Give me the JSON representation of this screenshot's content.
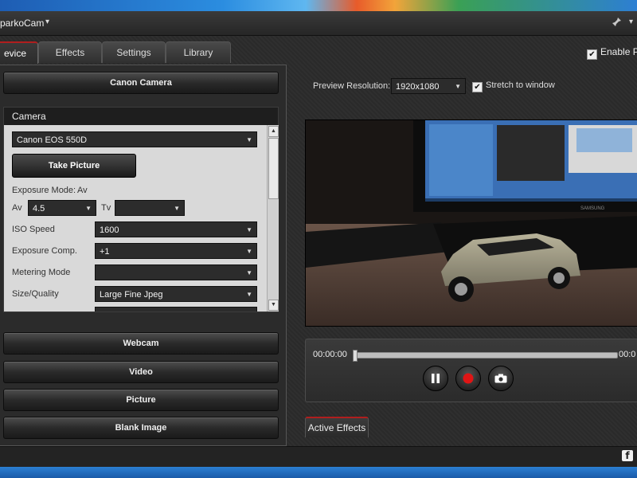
{
  "window": {
    "title": "parkoCam",
    "title_caret": "▾",
    "menu_caret": "▾"
  },
  "tabs": [
    {
      "label": "evice"
    },
    {
      "label": "Effects"
    },
    {
      "label": "Settings"
    },
    {
      "label": "Library"
    }
  ],
  "enable_preview": {
    "label": "Enable Pre",
    "checked": "✔"
  },
  "left": {
    "canon_button": "Canon Camera",
    "camera_group": {
      "header": "Camera",
      "camera_select": "Canon EOS 550D",
      "take_picture": "Take Picture",
      "exposure_mode_label": "Exposure Mode:",
      "exposure_mode_value": "Av",
      "av_label": "Av",
      "av_value": "4.5",
      "tv_label": "Tv",
      "tv_value": "",
      "iso_label": "ISO Speed",
      "iso_value": "1600",
      "expcomp_label": "Exposure Comp.",
      "expcomp_value": "+1",
      "metering_label": "Metering Mode",
      "metering_value": "",
      "size_label": "Size/Quality",
      "size_value": "Large Fine Jpeg"
    },
    "webcam_button": "Webcam",
    "video_button": "Video",
    "picture_button": "Picture",
    "blank_button": "Blank Image"
  },
  "preview": {
    "resolution_label": "Preview Resolution:",
    "resolution_value": "1920x1080",
    "stretch_label": "Stretch to window",
    "stretch_checked": "✔"
  },
  "playback": {
    "time_current": "00:00:00",
    "time_total": "00:0"
  },
  "active_effects_tab": "Active Effects",
  "status": {
    "facebook": "f"
  },
  "colors": {
    "accent": "#b01e1e"
  }
}
